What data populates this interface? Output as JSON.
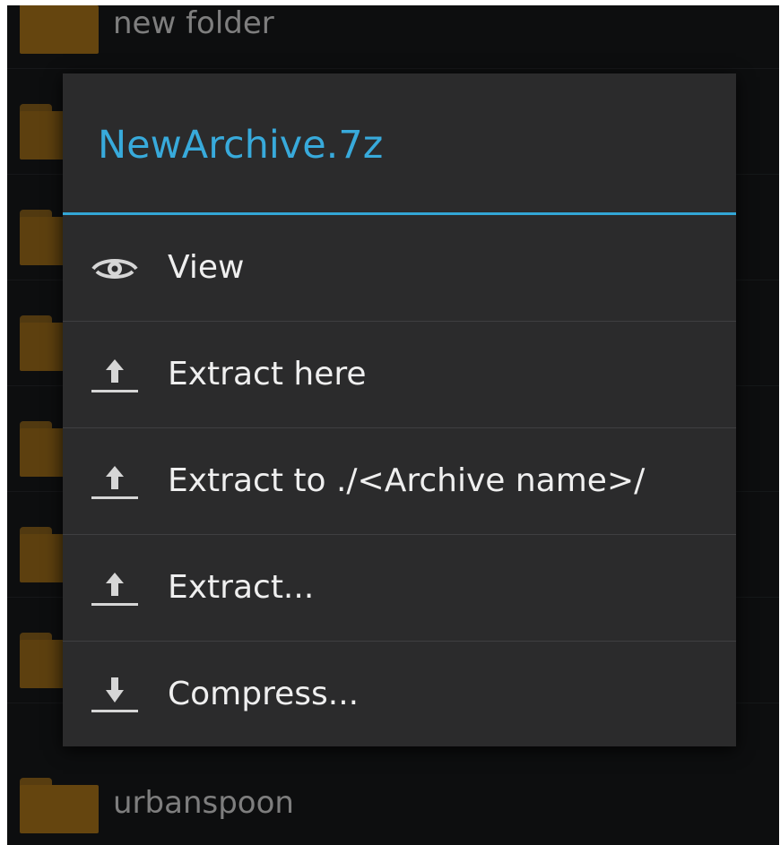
{
  "background_list": {
    "items": [
      {
        "name": "new folder"
      },
      {
        "name": ""
      },
      {
        "name": ""
      },
      {
        "name": ""
      },
      {
        "name": ""
      },
      {
        "name": ""
      },
      {
        "name": ""
      },
      {
        "name": "urbanspoon"
      }
    ]
  },
  "dialog": {
    "title": "NewArchive.7z",
    "items": [
      {
        "label": "View",
        "icon": "eye-icon"
      },
      {
        "label": "Extract here",
        "icon": "upload-arrow-icon"
      },
      {
        "label": "Extract to ./<Archive name>/",
        "icon": "upload-arrow-icon"
      },
      {
        "label": "Extract...",
        "icon": "upload-arrow-icon"
      },
      {
        "label": "Compress...",
        "icon": "download-arrow-icon"
      }
    ]
  },
  "colors": {
    "accent": "#33a6d6",
    "dialog_bg": "#2b2b2c",
    "screen_bg": "#0d0e0f",
    "folder": "#a06a10"
  }
}
